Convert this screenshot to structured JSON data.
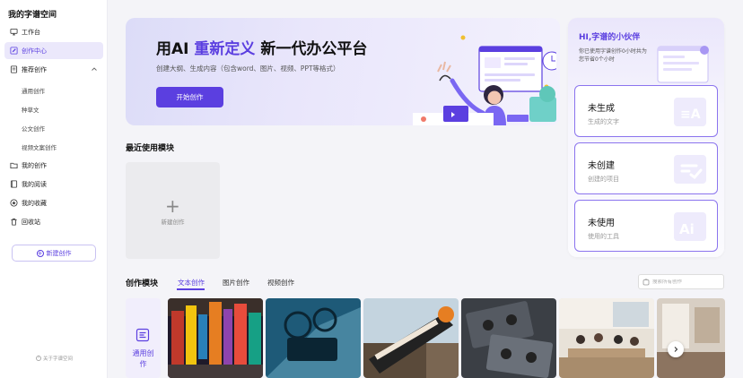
{
  "brand": "我的字谱空间",
  "sidebar": {
    "items": [
      {
        "label": "工作台"
      },
      {
        "label": "创作中心"
      },
      {
        "label": "推荐创作"
      }
    ],
    "sub_items": [
      "通用创作",
      "种草文",
      "公文创作",
      "视频文案创作"
    ],
    "items2": [
      {
        "label": "我的创作"
      },
      {
        "label": "我的阅读"
      },
      {
        "label": "我的收藏"
      },
      {
        "label": "回收站"
      }
    ],
    "new_button": "新建创作",
    "about": "关于字谱空间"
  },
  "banner": {
    "title_prefix": "用AI",
    "title_highlight": "重新定义",
    "title_suffix": "新一代办公平台",
    "subtitle": "创建大纲、生成内容（包含word、图片、视频、PPT等格式）",
    "button": "开始创作"
  },
  "side_panel": {
    "title": "HI,字谱的小伙伴",
    "note_line1": "你已使用字谱创作0小时共为",
    "note_line2": "您节省0个小时",
    "cards": [
      {
        "value": "未生成",
        "desc": "生成的文字"
      },
      {
        "value": "未创建",
        "desc": "创建的项目"
      },
      {
        "value": "未使用",
        "desc": "使用的工具"
      }
    ]
  },
  "recent": {
    "title": "最近使用模块",
    "new_label": "新建创作"
  },
  "modules": {
    "title": "创作模块",
    "tabs": [
      "文本创作",
      "图片创作",
      "视频创作"
    ],
    "search_placeholder": "搜索所有创作",
    "category_label": "通用创作"
  },
  "colors": {
    "accent": "#5b3fe0",
    "accent_light": "#ebe8fb"
  }
}
